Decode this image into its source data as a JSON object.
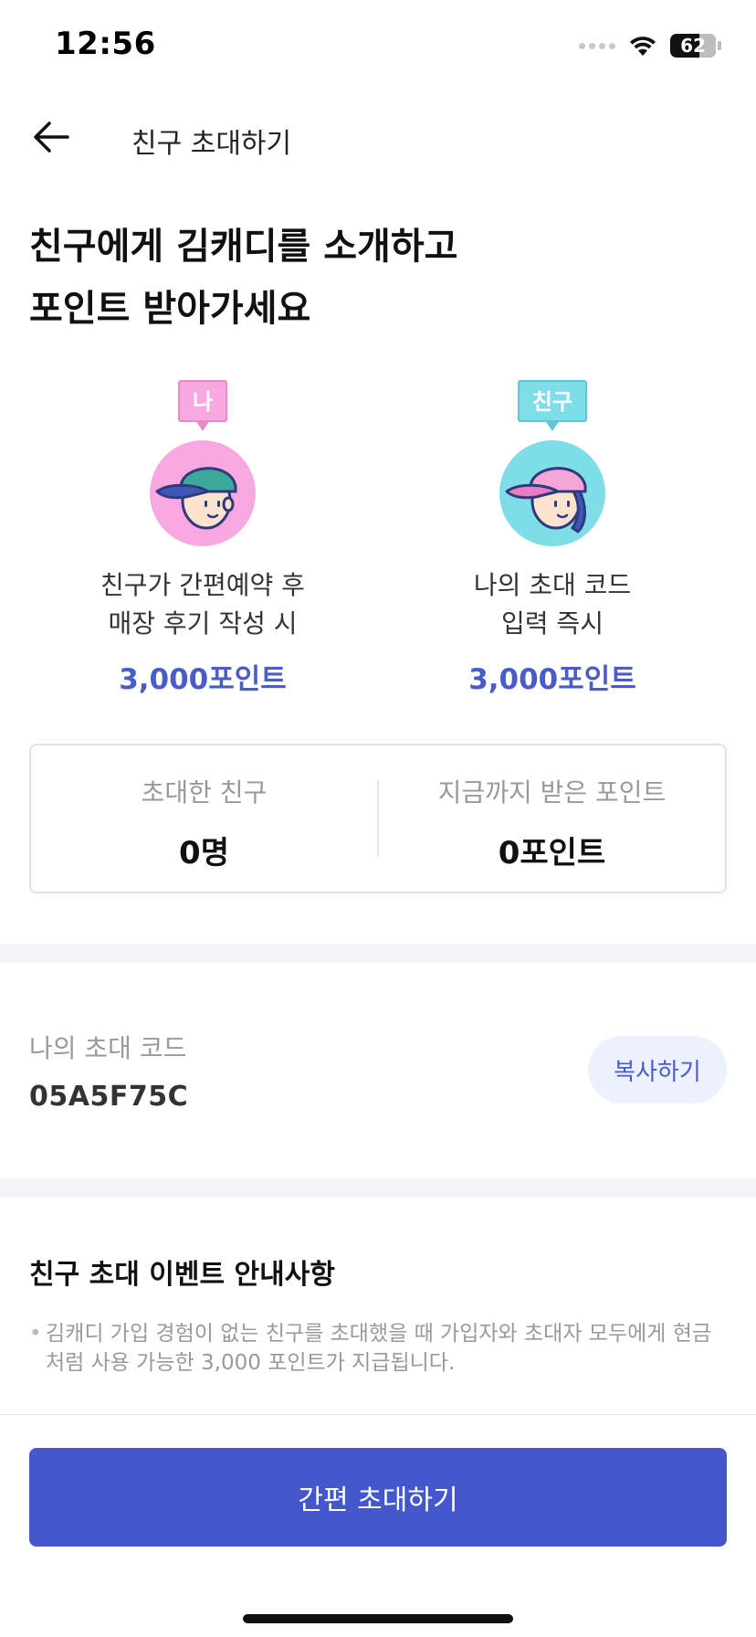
{
  "status_bar": {
    "time": "12:56",
    "battery": "62"
  },
  "header": {
    "back_icon": "arrow-left-icon",
    "title": "친구 초대하기"
  },
  "headline": {
    "line1": "친구에게 김캐디를 소개하고",
    "line2": "포인트 받아가세요"
  },
  "benefits": [
    {
      "tag": "나",
      "tag_color": "#f7a8e0",
      "avatar_bg": "#f7a8e0",
      "desc_line1": "친구가 간편예약 후",
      "desc_line2": "매장 후기 작성 시",
      "points": "3,000포인트"
    },
    {
      "tag": "친구",
      "tag_color": "#7fdde8",
      "avatar_bg": "#7fdde8",
      "desc_line1": "나의 초대 코드",
      "desc_line2": "입력 즉시",
      "points": "3,000포인트"
    }
  ],
  "stats": {
    "invited_label": "초대한 친구",
    "invited_value": "0명",
    "points_label": "지금까지 받은 포인트",
    "points_value": "0포인트"
  },
  "invite_code": {
    "label": "나의 초대 코드",
    "code": "05A5F75C",
    "copy_label": "복사하기"
  },
  "notice": {
    "title": "친구 초대 이벤트 안내사항",
    "items": [
      "김캐디 가입 경험이 없는 친구를 초대했을 때 가입자와 초대자 모두에게 현금처럼 사용 가능한 3,000 포인트가 지급됩니다."
    ]
  },
  "bottom": {
    "invite_button": "간편 초대하기"
  },
  "colors": {
    "accent": "#4458cc",
    "points_text": "#4a5cc7",
    "copy_bg": "#edf1fc"
  }
}
